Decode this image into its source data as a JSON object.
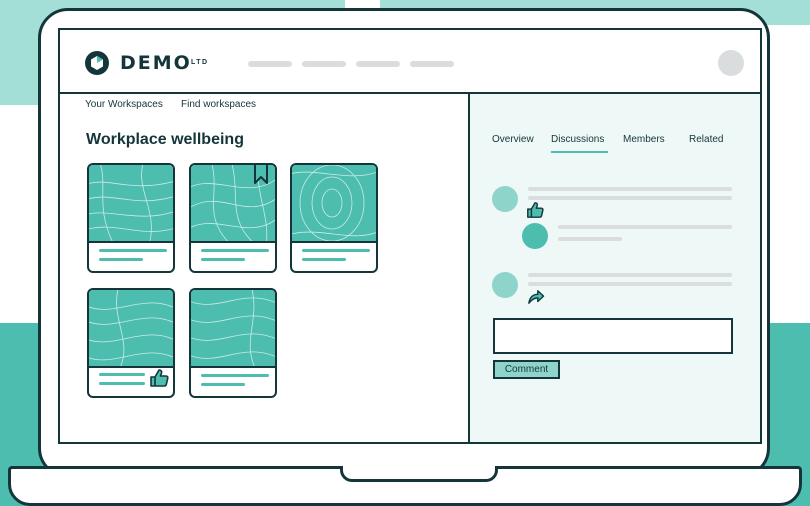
{
  "brand": {
    "name": "DEMO",
    "suffix": "LTD"
  },
  "breadcrumbs": [
    "Your Workspaces",
    "Find workspaces"
  ],
  "page_title": "Workplace wellbeing",
  "tabs": [
    "Overview",
    "Discussions",
    "Members",
    "Related"
  ],
  "active_tab": "Discussions",
  "comment_button_label": "Comment",
  "colors": {
    "accent": "#4dbdaf",
    "light_accent": "#a3dfd6",
    "outline": "#14363a",
    "placeholder": "#d9dddd",
    "panel_bg": "#eef8f6"
  },
  "icons": {
    "logo": "hexagon-logo-icon",
    "bookmark": "bookmark-icon",
    "like": "thumbs-up-icon",
    "share": "share-arrow-icon"
  }
}
